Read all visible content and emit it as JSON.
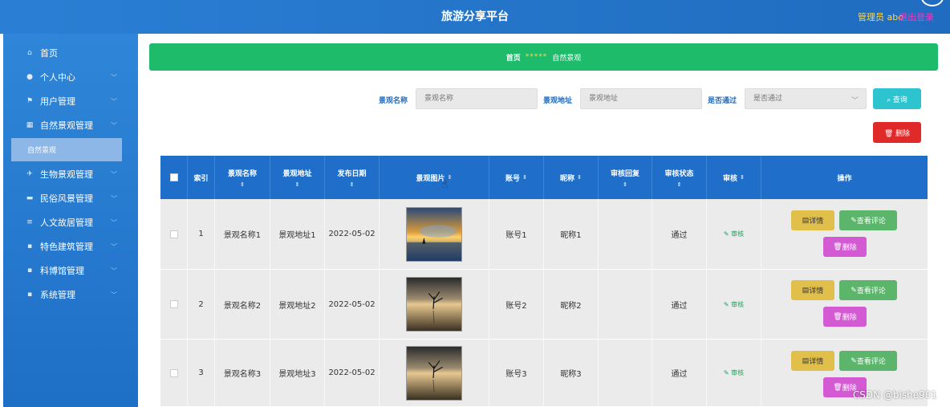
{
  "header": {
    "title": "旅游分享平台",
    "user_label": "管理员 abo",
    "logout_label": "退出登录"
  },
  "sidebar": {
    "items": [
      {
        "label": "首页",
        "icon": "home-icon",
        "glyph": "⌂"
      },
      {
        "label": "个人中心",
        "icon": "person-icon",
        "glyph": "●"
      },
      {
        "label": "用户管理",
        "icon": "flag-icon",
        "glyph": "⚑"
      },
      {
        "label": "自然景观管理",
        "icon": "grid-icon",
        "glyph": "▦"
      },
      {
        "label": "生物景观管理",
        "icon": "pin-icon",
        "glyph": "✈"
      },
      {
        "label": "民俗风景管理",
        "icon": "card-icon",
        "glyph": "▬"
      },
      {
        "label": "人文故居管理",
        "icon": "list-icon",
        "glyph": "≡"
      },
      {
        "label": "特色建筑管理",
        "icon": "apps-icon",
        "glyph": "▪"
      },
      {
        "label": "科博馆管理",
        "icon": "apps-icon",
        "glyph": "▪"
      },
      {
        "label": "系统管理",
        "icon": "apps-icon",
        "glyph": "▪"
      }
    ],
    "active_sub": "自然景观"
  },
  "breadcrumb": {
    "home": "首页",
    "separator": "*****",
    "current": "自然景观"
  },
  "search": {
    "name_label": "景观名称",
    "name_placeholder": "景观名称",
    "addr_label": "景观地址",
    "addr_placeholder": "景观地址",
    "pass_label": "是否通过",
    "pass_placeholder": "是否通过",
    "query_label": "查询",
    "delete_label": "删除"
  },
  "table": {
    "headers": [
      "索引",
      "景观名称",
      "景观地址",
      "发布日期",
      "景观图片",
      "账号",
      "昵称",
      "审核回复",
      "审核状态",
      "审核",
      "操作"
    ],
    "rows": [
      {
        "index": "1",
        "name": "景观名称1",
        "addr": "景观地址1",
        "date": "2022-05-02",
        "account": "账号1",
        "nick": "昵称1",
        "reply": "",
        "status": "通过",
        "audit": "审核"
      },
      {
        "index": "2",
        "name": "景观名称2",
        "addr": "景观地址2",
        "date": "2022-05-02",
        "account": "账号2",
        "nick": "昵称2",
        "reply": "",
        "status": "通过",
        "audit": "审核"
      },
      {
        "index": "3",
        "name": "景观名称3",
        "addr": "景观地址3",
        "date": "2022-05-02",
        "account": "账号3",
        "nick": "昵称3",
        "reply": "",
        "status": "通过",
        "audit": "审核"
      }
    ],
    "actions": {
      "detail": "详情",
      "review": "查看评论",
      "remove": "删除"
    }
  },
  "watermark": "CSDN @bishe901",
  "colors": {
    "primary": "#1f6fca",
    "success": "#1dbb6a",
    "danger": "#e02a2a"
  }
}
